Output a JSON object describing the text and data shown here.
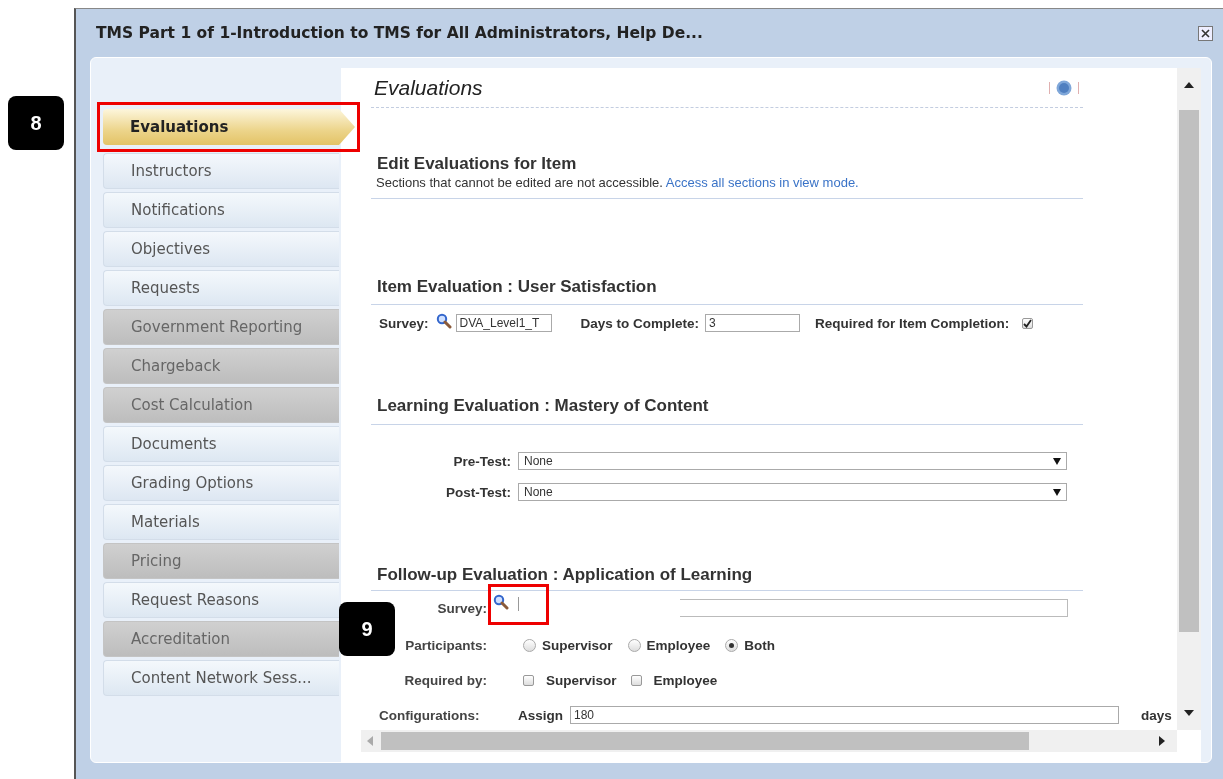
{
  "window": {
    "title": "TMS Part 1 of 1-Introduction to TMS for All Administrators, Help De..."
  },
  "callouts": [
    {
      "label": "8"
    },
    {
      "label": "9"
    }
  ],
  "sidebar": {
    "items": [
      {
        "label": "Evaluations",
        "selected": true,
        "disabled": false,
        "highlighted": true
      },
      {
        "label": "Instructors",
        "selected": false,
        "disabled": false
      },
      {
        "label": "Notifications",
        "selected": false,
        "disabled": false
      },
      {
        "label": "Objectives",
        "selected": false,
        "disabled": false
      },
      {
        "label": "Requests",
        "selected": false,
        "disabled": false
      },
      {
        "label": "Government Reporting",
        "selected": false,
        "disabled": true
      },
      {
        "label": "Chargeback",
        "selected": false,
        "disabled": true
      },
      {
        "label": "Cost Calculation",
        "selected": false,
        "disabled": true
      },
      {
        "label": "Documents",
        "selected": false,
        "disabled": false
      },
      {
        "label": "Grading Options",
        "selected": false,
        "disabled": false
      },
      {
        "label": "Materials",
        "selected": false,
        "disabled": false
      },
      {
        "label": "Pricing",
        "selected": false,
        "disabled": true
      },
      {
        "label": "Request Reasons",
        "selected": false,
        "disabled": false
      },
      {
        "label": "Accreditation",
        "selected": false,
        "disabled": true
      },
      {
        "label": "Content Network Sess...",
        "selected": false,
        "disabled": false
      }
    ]
  },
  "content": {
    "title": "Evaluations",
    "heading": "Edit Evaluations for Item",
    "note": "Sections that cannot be edited are not accessible.",
    "note_link": "Access all sections in view mode.",
    "item_evaluation": {
      "heading": "Item Evaluation : User Satisfaction",
      "survey_label": "Survey:",
      "survey_value": "DVA_Level1_T",
      "days_label": "Days to Complete:",
      "days_value": "3",
      "required_label": "Required for Item Completion:",
      "required_checked": true
    },
    "learning_evaluation": {
      "heading": "Learning Evaluation : Mastery of Content",
      "fields": [
        {
          "label": "Pre-Test:",
          "value": "None"
        },
        {
          "label": "Post-Test:",
          "value": "None"
        }
      ]
    },
    "followup_evaluation": {
      "heading": "Follow-up Evaluation : Application of Learning",
      "survey_label": "Survey:",
      "survey_highlighted": true,
      "participants_label": "Participants:",
      "participants": [
        {
          "label": "Supervisor",
          "selected": false
        },
        {
          "label": "Employee",
          "selected": false
        },
        {
          "label": "Both",
          "selected": true
        }
      ],
      "required_label": "Required by:",
      "required_by": [
        {
          "label": "Supervisor",
          "checked": false
        },
        {
          "label": "Employee",
          "checked": false
        }
      ],
      "config_label": "Configurations:",
      "assign_label": "Assign",
      "assign_value": "180",
      "unit": "days"
    }
  }
}
